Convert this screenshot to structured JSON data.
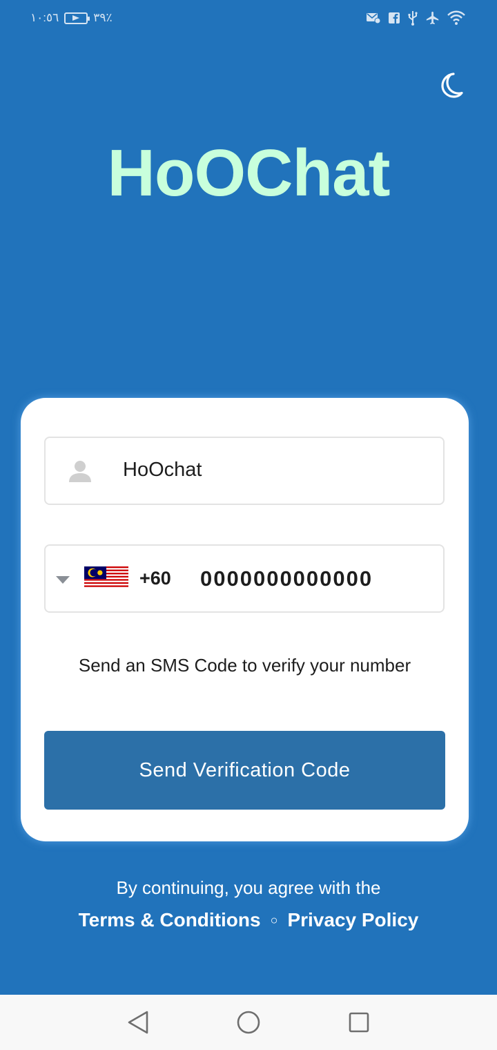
{
  "status_bar": {
    "time": "١٠:٥٦",
    "battery": "٣٩٪",
    "icons": [
      "mail-settings-icon",
      "facebook-icon",
      "usb-icon",
      "airplane-icon",
      "wifi-icon"
    ]
  },
  "app": {
    "title": "HoOChat",
    "theme_icon": "moon-icon"
  },
  "form": {
    "name_value": "HoOchat",
    "country_flag": "malaysia-flag",
    "dial_code": "+60",
    "phone_value": "0000000000000",
    "sms_hint": "Send an SMS Code to verify your number",
    "send_button_label": "Send Verification Code"
  },
  "legal": {
    "intro": "By continuing, you agree with the",
    "terms_label": "Terms & Conditions",
    "separator": "○",
    "privacy_label": "Privacy Policy"
  },
  "nav_bar": {
    "icons": [
      "back-icon",
      "home-icon",
      "recents-icon"
    ]
  },
  "colors": {
    "background": "#2173bb",
    "title": "#c8ffdc",
    "button": "#2c70a8",
    "card": "#ffffff"
  }
}
